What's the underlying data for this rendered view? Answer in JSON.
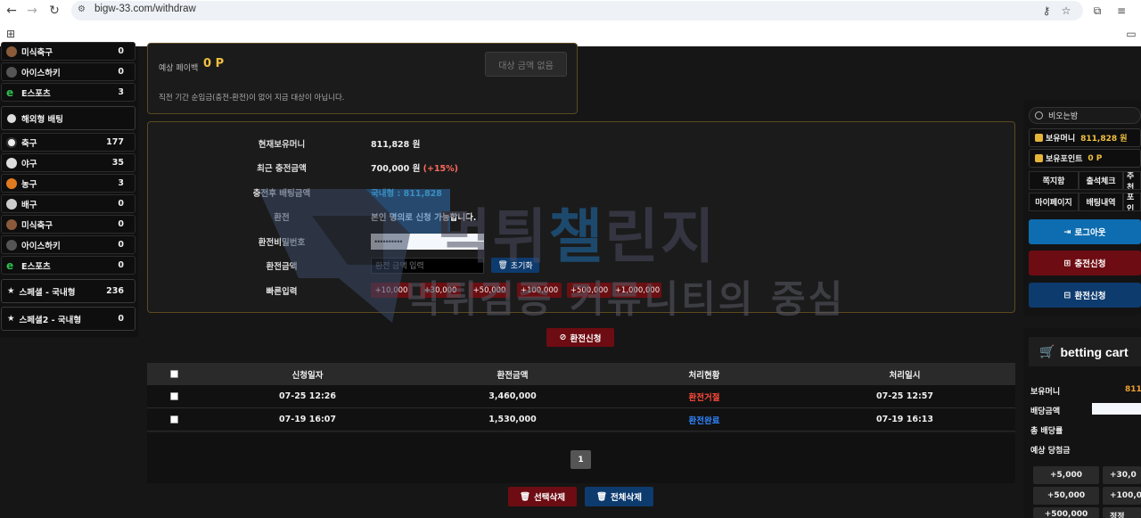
{
  "browser": {
    "url": "bigw-33.com/withdraw"
  },
  "sidebar": {
    "top_items": [
      {
        "label": "미식축구",
        "count": "0",
        "icon_color": "#8a5a3a",
        "icon": "american-football-icon"
      },
      {
        "label": "아이스하키",
        "count": "0",
        "icon_color": "#555",
        "icon": "puck-icon"
      },
      {
        "label": "E스포츠",
        "count": "3",
        "icon_color": "#2fbf4f",
        "icon": "esports-icon"
      }
    ],
    "overseas_header": "해외형 배팅",
    "items": [
      {
        "label": "축구",
        "count": "177",
        "icon_color": "#eeeeee",
        "icon": "soccer-icon"
      },
      {
        "label": "야구",
        "count": "35",
        "icon_color": "#dddddd",
        "icon": "baseball-icon"
      },
      {
        "label": "농구",
        "count": "3",
        "icon_color": "#e07a20",
        "icon": "basketball-icon"
      },
      {
        "label": "배구",
        "count": "0",
        "icon_color": "#cccccc",
        "icon": "volleyball-icon"
      },
      {
        "label": "미식축구",
        "count": "0",
        "icon_color": "#8a5a3a",
        "icon": "american-football-icon"
      },
      {
        "label": "아이스하키",
        "count": "0",
        "icon_color": "#555",
        "icon": "puck-icon"
      },
      {
        "label": "E스포츠",
        "count": "0",
        "icon_color": "#2fbf4f",
        "icon": "esports-icon"
      }
    ],
    "specials": [
      {
        "label": "스페셜 - 국내형",
        "count": "236"
      },
      {
        "label": "스페셜2 - 국내형",
        "count": "0"
      }
    ]
  },
  "expected": {
    "label": "예상 페이백",
    "value": "0 P",
    "button": "대상 금액 없음",
    "note": "직전 기간 순입금(충전-환전)이 없어 지금 대상이 아닙니다."
  },
  "form": {
    "rows": [
      {
        "label": "현재보유머니",
        "value": "811,828 원"
      },
      {
        "label": "최근 충전금액",
        "value": "700,000 원",
        "extra": "(+15%)"
      },
      {
        "label": "충전후 배팅금액",
        "value": "국내형 : 811,828"
      },
      {
        "label": "환전",
        "value": "본인 명의로 신청 가능합니다."
      },
      {
        "label": "환전비밀번호"
      },
      {
        "label": "환전금액"
      },
      {
        "label": "빠른입력"
      }
    ],
    "password_value": "••••••••••",
    "amount_placeholder": "환전 금액 입력",
    "reset_label": "초기화",
    "quick_buttons": [
      "+10,000",
      "+30,000",
      "+50,000",
      "+100,000",
      "+500,000",
      "+1,000,000"
    ],
    "submit_label": "환전신청"
  },
  "watermark": {
    "line1_a": "먹튀",
    "line1_b": "챌",
    "line1_c": "린지",
    "line2": "먹튀검증 커뮤니티의 중심"
  },
  "table": {
    "headers": [
      "신청일자",
      "환전금액",
      "처리현황",
      "처리일시"
    ],
    "rows": [
      {
        "date": "07-25 12:26",
        "amount": "3,460,000",
        "status": "환전거절",
        "status_color": "#ff4a3a",
        "done": "07-25 12:57"
      },
      {
        "date": "07-19 16:07",
        "amount": "1,530,000",
        "status": "환전완료",
        "status_color": "#2f86ff",
        "done": "07-19 16:13"
      }
    ],
    "page": "1",
    "delete_selected": "선택삭제",
    "delete_all": "전체삭제"
  },
  "right": {
    "user": "비오는밤",
    "money_label": "보유머니",
    "money_value": "811,828 원",
    "point_label": "보유포인트",
    "point_value": "0 P",
    "grid": [
      "쪽지함",
      "출석체크",
      "추천",
      "마이페이지",
      "배팅내역",
      "포인"
    ],
    "logout": "로그아웃",
    "deposit": "충전신청",
    "withdraw": "환전신청",
    "colors": {
      "logout": "#0e6db0",
      "deposit": "#6d0c12",
      "withdraw": "#0d3b6e"
    }
  },
  "cart": {
    "title": "betting cart",
    "rows": [
      {
        "label": "보유머니",
        "value": "811"
      },
      {
        "label": "배당금액"
      },
      {
        "label": "총 배당률"
      },
      {
        "label": "예상 당첨금"
      }
    ],
    "buttons": [
      "+5,000",
      "+30,0",
      "+50,000",
      "+100,0",
      "+500,000",
      "정정"
    ]
  }
}
